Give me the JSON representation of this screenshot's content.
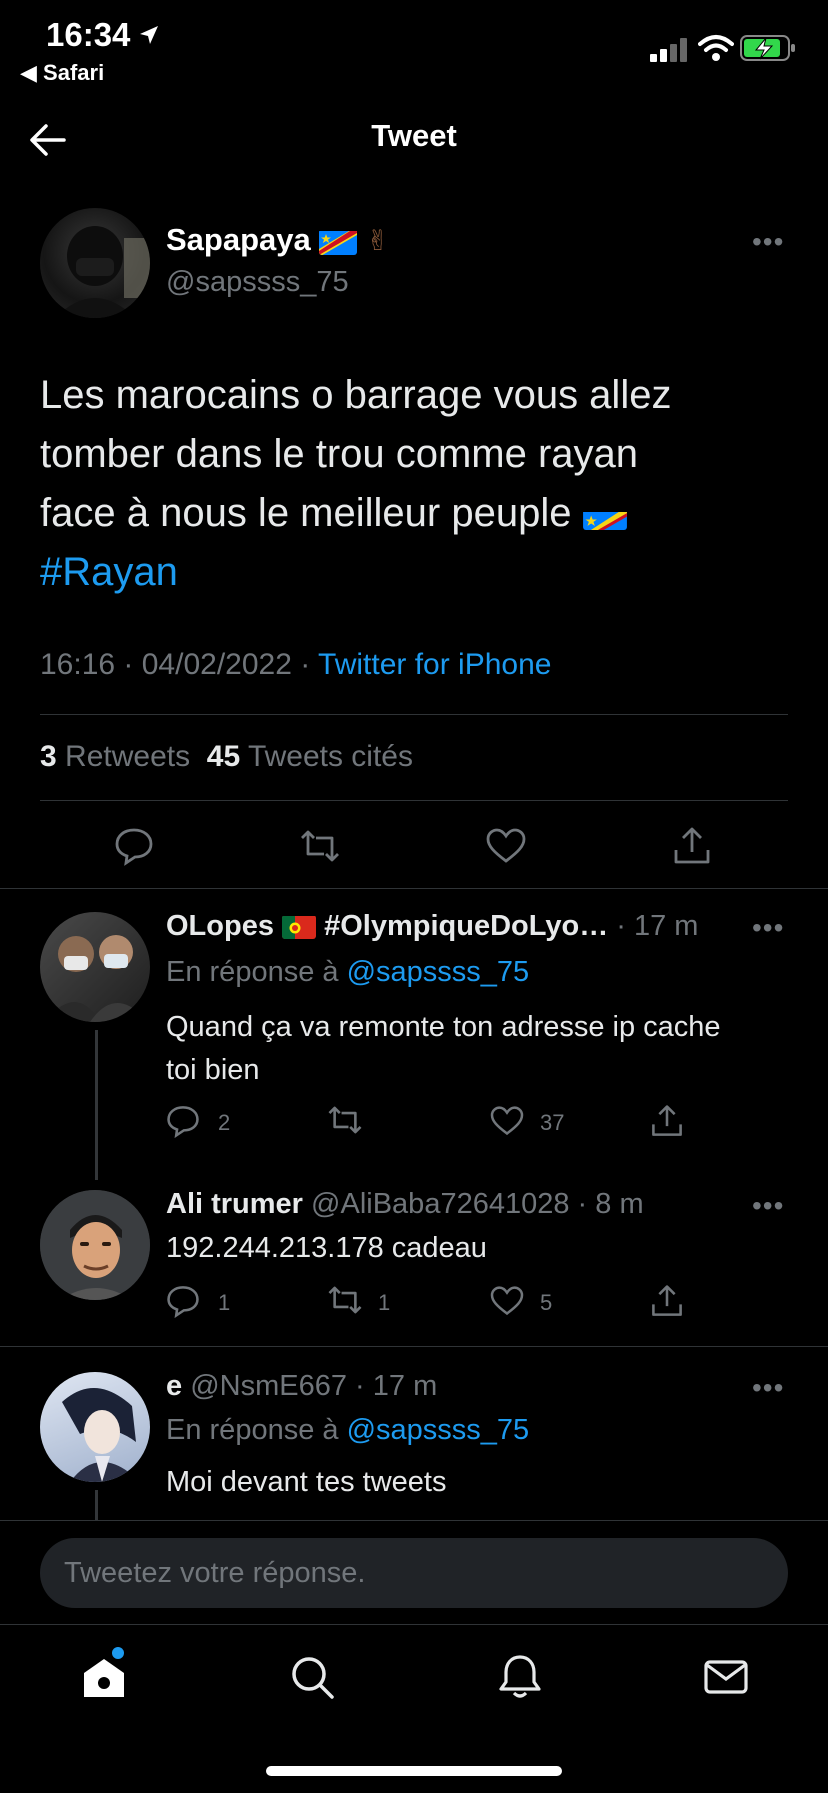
{
  "status_bar": {
    "time": "16:34",
    "back_app": "Safari"
  },
  "header": {
    "title": "Tweet"
  },
  "main_tweet": {
    "author_name": "Sapapaya",
    "author_handle": "@sapssss_75",
    "text_line1": "Les marocains o barrage vous allez",
    "text_line2": "tomber dans le trou comme rayan",
    "text_line3": "face à nous le meilleur peuple",
    "hashtag": "#Rayan",
    "time": "16:16",
    "date": "04/02/2022",
    "source": "Twitter for iPhone",
    "retweets_count": "3",
    "retweets_label": "Retweets",
    "quotes_count": "45",
    "quotes_label": "Tweets cités"
  },
  "replies": [
    {
      "author_name": "OLopes",
      "author_extra": "#OlympiqueDoLyo…",
      "meta": "· 17 m",
      "reply_to_label": "En réponse à",
      "reply_to_handle": "@sapssss_75",
      "text_line1": "Quand ça va remonte ton adresse ip cache",
      "text_line2": "toi bien",
      "replies": "2",
      "retweets": "",
      "likes": "37"
    },
    {
      "author_name": "Ali trumer",
      "author_handle": "@AliBaba72641028",
      "meta": "· 8 m",
      "text": "192.244.213.178 cadeau",
      "replies": "1",
      "retweets": "1",
      "likes": "5"
    },
    {
      "author_name": "e",
      "author_handle": "@NsmE667",
      "meta": "· 17 m",
      "reply_to_label": "En réponse à",
      "reply_to_handle": "@sapssss_75",
      "text": "Moi devant tes tweets"
    }
  ],
  "composer": {
    "placeholder": "Tweetez votre réponse."
  },
  "colors": {
    "accent": "#1d9bf0",
    "muted": "#71767b",
    "background": "#000000"
  }
}
